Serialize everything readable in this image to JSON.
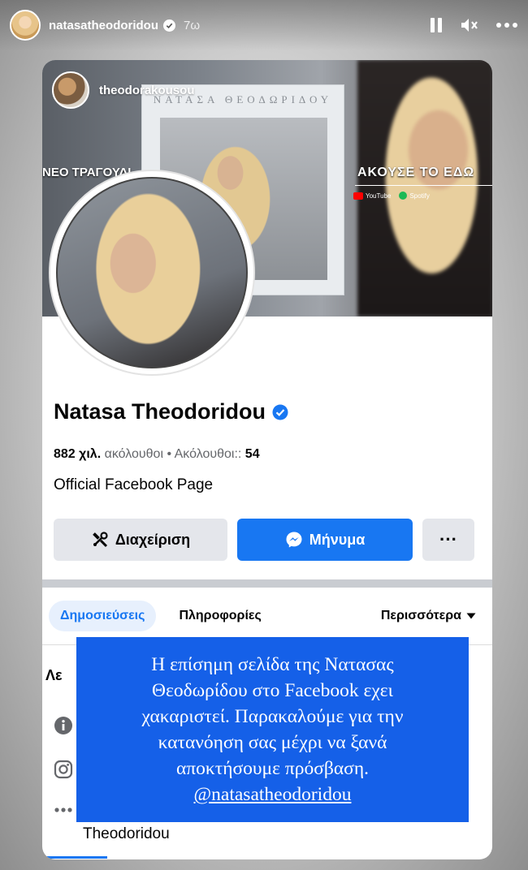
{
  "story": {
    "username": "natasatheodoridou",
    "time": "7ω",
    "icons": [
      "pause-icon",
      "mute-icon",
      "more-icon"
    ]
  },
  "cover": {
    "poster_name": "theodorakousou",
    "album_title": "ΝΑΤΑΣΑ ΘΕΟΔΩΡΙΔΟΥ",
    "left_text": "ΝΕΟ ΤΡΑΓΟΥΔΙ",
    "right_text": "ΑΚΟΥΣΕ ΤΟ ΕΔΩ",
    "links": [
      "YouTube",
      "Spotify"
    ]
  },
  "page": {
    "name": "Natasa Theodoridou",
    "followers_count": "882 χιλ.",
    "followers_label": "ακόλουθοι",
    "following_label": "Ακόλουθοι::",
    "following_count": "54",
    "description": "Official Facebook Page"
  },
  "buttons": {
    "manage": "Διαχείριση",
    "message": "Μήνυμα",
    "more": "···"
  },
  "tabs": {
    "posts": "Δημοσιεύσεις",
    "about": "Πληροφορίες",
    "more": "Περισσότερα"
  },
  "below": {
    "partial_title": "Λε",
    "bottom_name": "Theodoridou"
  },
  "caption": {
    "lines": [
      "Η επίσημη σελίδα της Νατασας",
      "Θεοδωρίδου στο Facebook εχει",
      "χακαριστεί. Παρακαλούμε για την",
      "κατανόηση σας μέχρι να ξανά",
      "αποκτήσουμε πρόσβαση."
    ],
    "mention": "@natasatheodoridou"
  },
  "colors": {
    "facebook_blue": "#1877f2",
    "caption_blue": "#1560e8",
    "button_gray": "#e4e6eb"
  }
}
